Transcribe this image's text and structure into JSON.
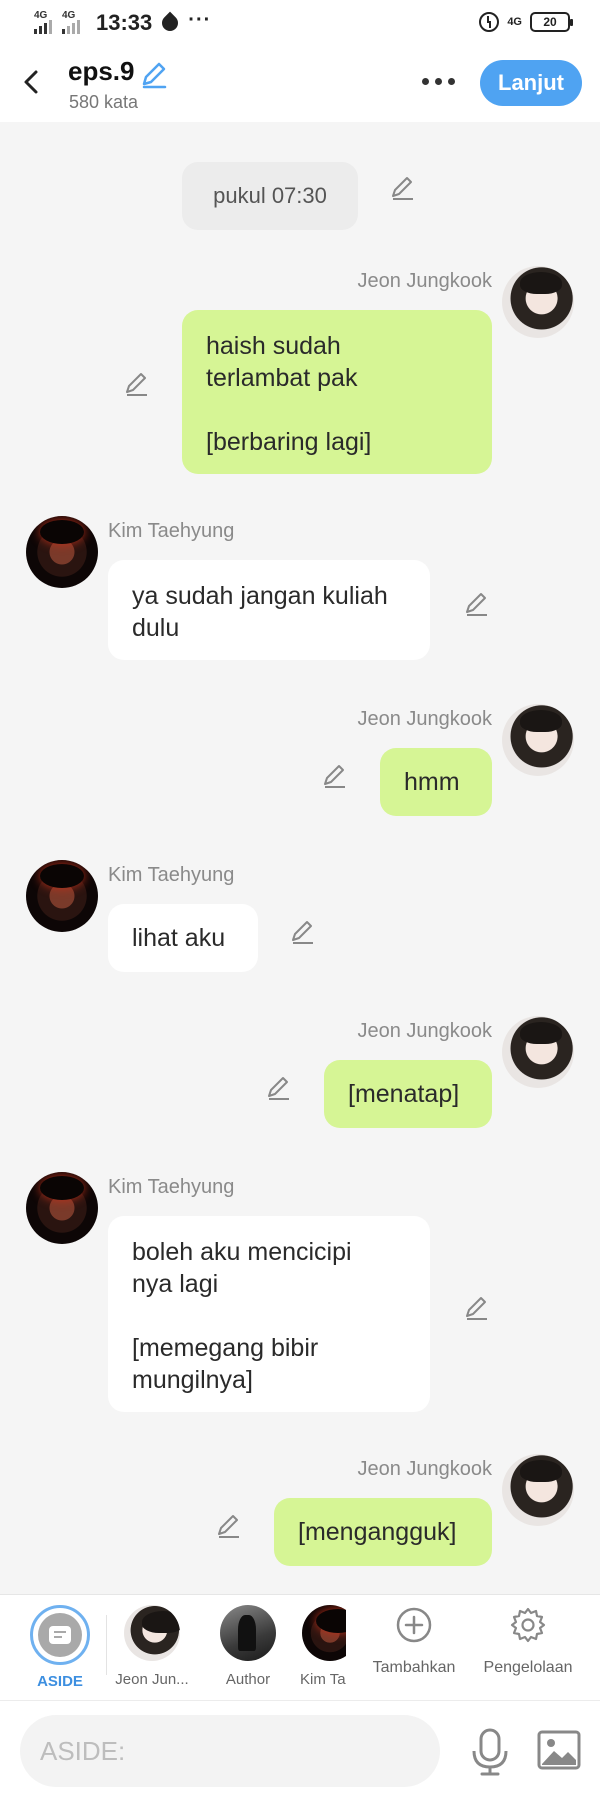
{
  "status_bar": {
    "net1": "4G",
    "net2": "4G",
    "time": "13:33",
    "dots": "···",
    "net_right": "4G",
    "battery": "20"
  },
  "header": {
    "title": "eps.9",
    "word_count": "580 kata",
    "next_label": "Lanjut"
  },
  "time_marker": "pukul 07:30",
  "messages": [
    {
      "side": "right",
      "sender": "Jeon Jungkook",
      "text": "haish sudah\nterlambat pak\n\n[berbaring lagi]"
    },
    {
      "side": "left",
      "sender": "Kim Taehyung",
      "text": "ya sudah jangan kuliah\ndulu"
    },
    {
      "side": "right",
      "sender": "Jeon Jungkook",
      "text": "hmm"
    },
    {
      "side": "left",
      "sender": "Kim Taehyung",
      "text": "lihat aku"
    },
    {
      "side": "right",
      "sender": "Jeon Jungkook",
      "text": "[menatap]"
    },
    {
      "side": "left",
      "sender": "Kim Taehyung",
      "text": "boleh aku mencicipi\nnya lagi\n\n[memegang bibir\nmungilnya]"
    },
    {
      "side": "right",
      "sender": "Jeon Jungkook",
      "text": "[mengangguk]"
    }
  ],
  "character_bar": {
    "aside_label": "ASIDE",
    "characters": [
      "Jeon Jun...",
      "Author",
      "Kim Ta"
    ],
    "add_label": "Tambahkan",
    "manage_label": "Pengelolaan"
  },
  "input": {
    "placeholder": "ASIDE:"
  },
  "colors": {
    "accent": "#4fa3f2",
    "my_bubble": "#d6f595",
    "their_bubble": "#ffffff",
    "background": "#f5f5f5"
  }
}
